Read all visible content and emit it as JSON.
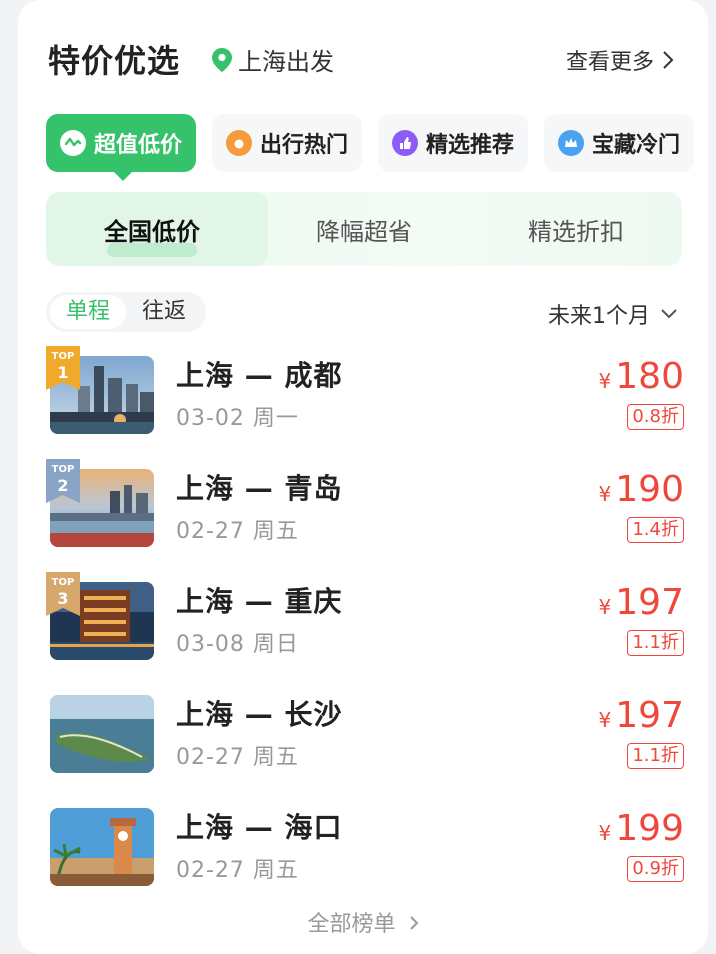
{
  "header": {
    "title": "特价优选",
    "location": "上海出发",
    "more_label": "查看更多"
  },
  "categories": [
    {
      "label": "超值低价",
      "icon": "chart-wave-icon",
      "active": true
    },
    {
      "label": "出行热门",
      "icon": "fire-icon",
      "active": false
    },
    {
      "label": "精选推荐",
      "icon": "thumbs-up-icon",
      "active": false
    },
    {
      "label": "宝藏冷门",
      "icon": "crown-icon",
      "active": false
    }
  ],
  "subtabs": [
    "全国低价",
    "降幅超省",
    "精选折扣"
  ],
  "trip_type": {
    "options": [
      "单程",
      "往返"
    ],
    "selected": "单程"
  },
  "period": "未来1个月",
  "currency_symbol": "¥",
  "routes": [
    {
      "rank_badge": "TOP",
      "rank": "1",
      "route": "上海 — 成都",
      "date": "03-02 周一",
      "price": "180",
      "discount": "0.8折",
      "badge_color": "#f0a92b"
    },
    {
      "rank_badge": "TOP",
      "rank": "2",
      "route": "上海 — 青岛",
      "date": "02-27 周五",
      "price": "190",
      "discount": "1.4折",
      "badge_color": "#8aa4c8"
    },
    {
      "rank_badge": "TOP",
      "rank": "3",
      "route": "上海 — 重庆",
      "date": "03-08 周日",
      "price": "197",
      "discount": "1.1折",
      "badge_color": "#d7a86e"
    },
    {
      "route": "上海 — 长沙",
      "date": "02-27 周五",
      "price": "197",
      "discount": "1.1折"
    },
    {
      "route": "上海 — 海口",
      "date": "02-27 周五",
      "price": "199",
      "discount": "0.9折"
    }
  ],
  "footer_label": "全部榜单",
  "colors": {
    "accent": "#35c26a",
    "price": "#f0473c"
  }
}
